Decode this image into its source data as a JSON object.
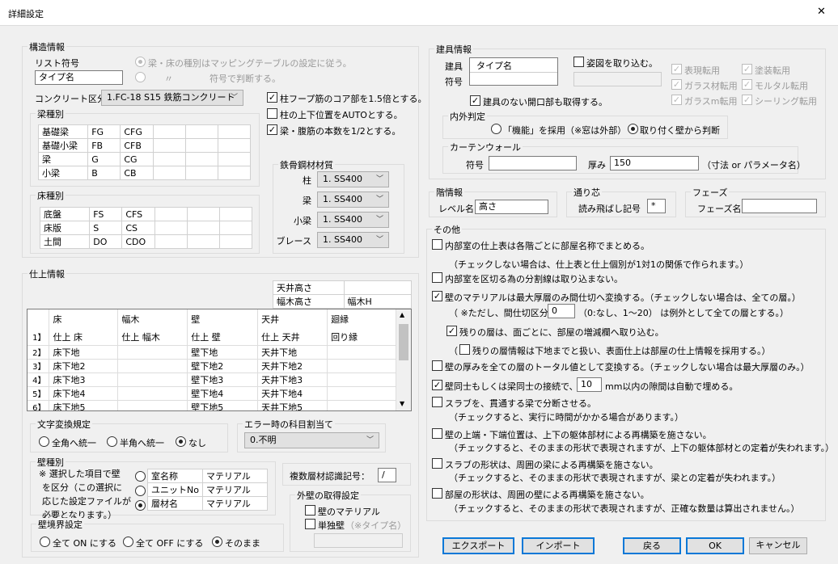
{
  "window": {
    "title": "詳細設定",
    "close": "✕"
  },
  "structure": {
    "title": "構造情報",
    "list_label": "リスト符号",
    "list_value": "タイプ名",
    "radio1": "梁・床の種別はマッピングテーブルの設定に従う。",
    "radio2_ditto": "〃",
    "radio2": "符号で判断する。",
    "concrete_label": "コンクリート区分",
    "concrete_value": "1.FC-18 S15 鉄筋コンクリート",
    "beam_title": "梁種別",
    "beam_rows": [
      [
        "基礎梁",
        "FG",
        "CFG",
        "",
        "",
        ""
      ],
      [
        "基礎小梁",
        "FB",
        "CFB",
        "",
        "",
        ""
      ],
      [
        "梁",
        "G",
        "CG",
        "",
        "",
        ""
      ],
      [
        "小梁",
        "B",
        "CB",
        "",
        "",
        ""
      ]
    ],
    "floor_title": "床種別",
    "floor_rows": [
      [
        "底盤",
        "FS",
        "CFS",
        "",
        "",
        ""
      ],
      [
        "床版",
        "S",
        "CS",
        "",
        "",
        ""
      ],
      [
        "土間",
        "DO",
        "CDO",
        "",
        "",
        ""
      ]
    ],
    "checks": [
      {
        "label": "柱フープ筋のコア部を1.5倍とする。",
        "checked": true
      },
      {
        "label": "柱の上下位置をAUTOとする。",
        "checked": false
      },
      {
        "label": "梁・腹筋の本数を1/2とする。",
        "checked": true
      }
    ],
    "steel_title": "鉄骨鋼材材質",
    "steel": [
      {
        "label": "柱",
        "value": "1. SS400"
      },
      {
        "label": "梁",
        "value": "1. SS400"
      },
      {
        "label": "小梁",
        "value": "1. SS400"
      },
      {
        "label": "ブレース",
        "value": "1. SS400"
      }
    ]
  },
  "finish": {
    "title": "仕上情報",
    "height_rows": [
      [
        "天井高さ",
        ""
      ],
      [
        "幅木高さ",
        "幅木H"
      ]
    ],
    "grid_header": [
      "",
      "床",
      "幅木",
      "壁",
      "天井",
      "廻縁"
    ],
    "grid_rows": [
      [
        "1】",
        "仕上 床",
        "仕上 幅木",
        "仕上 壁",
        "仕上 天井",
        "回り縁"
      ],
      [
        "2】",
        "床下地",
        "",
        "壁下地",
        "天井下地",
        ""
      ],
      [
        "3】",
        "床下地2",
        "",
        "壁下地2",
        "天井下地2",
        ""
      ],
      [
        "4】",
        "床下地3",
        "",
        "壁下地3",
        "天井下地3",
        ""
      ],
      [
        "5】",
        "床下地4",
        "",
        "壁下地4",
        "天井下地4",
        ""
      ],
      [
        "6】",
        "床下地5",
        "",
        "壁下地5",
        "天井下地5",
        ""
      ]
    ],
    "charconv_title": "文字変換規定",
    "charconv": [
      "全角へ統一",
      "半角へ統一",
      "なし"
    ],
    "error_title": "エラー時の科目割当て",
    "error_value": "0.不明",
    "walltype_title": "壁種別",
    "walltype_note": [
      "※ 選択した項目で壁",
      "を区分（この選択に",
      "応じた設定ファイルが",
      "必要となります。）"
    ],
    "walltype_rows": [
      [
        "室名称",
        "マテリアル"
      ],
      [
        "ユニットNo",
        "マテリアル"
      ],
      [
        "層材名",
        "マテリアル"
      ]
    ],
    "multi_label": "複数層材認識記号：",
    "multi_value": "/",
    "outer_title": "外壁の取得設定",
    "outer_cb1": "壁のマテリアル",
    "outer_cb2": "単独壁",
    "outer_cb2_note": "（※タイプ名）",
    "boundary_title": "壁境界設定",
    "boundary": [
      "全て ON にする",
      "全て OFF にする",
      "そのまま"
    ]
  },
  "fittings": {
    "title": "建具情報",
    "label1": "建具",
    "label2": "符号",
    "list_value": "タイプ名",
    "elev_cb": "姿図を取り込む。",
    "disabled_checks": [
      "表現転用",
      "塗装転用",
      "ガラス材転用",
      "モルタル転用",
      "ガラスm転用",
      "シーリング転用"
    ],
    "opening_cb": "建具のない開口部も取得する。",
    "inout_title": "内外判定",
    "inout": [
      "「機能」を採用（※窓は外部）",
      "取り付く壁から判断"
    ],
    "cw_title": "カーテンウォール",
    "cw_code_label": "符号",
    "cw_code": "",
    "cw_thick_label": "厚み",
    "cw_thick": "150",
    "cw_note": "（寸法 or パラメータ名）"
  },
  "level": {
    "title": "階情報",
    "label": "レベル名",
    "value": "高さ"
  },
  "grid": {
    "title": "通り芯",
    "label": "読み飛ばし記号",
    "value": "*"
  },
  "phase": {
    "title": "フェーズ",
    "label": "フェーズ名",
    "value": ""
  },
  "other": {
    "title": "その他",
    "c1": "内部室の仕上表は各階ごとに部屋名称でまとめる。",
    "c1n": "（チェックしない場合は、仕上表と仕上個別が1対1の関係で作られます。）",
    "c2": "内部室を区切る為の分割線は取り込まない。",
    "c3": "壁のマテリアルは最大厚層のみ間仕切へ変換する。（チェックしない場合は、全ての層。）",
    "c3a": "（ ※ただし、間仕切区分",
    "c3v": "0",
    "c3b": "（0:なし、1～20） は例外として全ての層とする。）",
    "c4": "残りの層は、面ごとに、部屋の増減欄へ取り込む。",
    "c5pre": "（",
    "c5": "残りの層情報は下地までと扱い、表面仕上は部屋の仕上情報を採用する。）",
    "c6": "壁の厚みを全ての層のトータル値として変換する。（チェックしない場合は最大厚層のみ。）",
    "c7": "壁同士もしくは梁同士の接続で、",
    "c7v": "10",
    "c7b": "mm以内の隙間は自動で埋める。",
    "c8": "スラブを、貫通する梁で分断させる。",
    "c8n": "（チェックすると、実行に時間がかかる場合があります。）",
    "c9": "壁の上端・下端位置は、上下の躯体部材による再構築を施さない。",
    "c9n": "（チェックすると、そのままの形状で表現されますが、上下の躯体部材との定着が失われます。）",
    "c10": "スラブの形状は、周囲の梁による再構築を施さない。",
    "c10n": "（チェックすると、そのままの形状で表現されますが、梁との定着が失われます。）",
    "c11": "部屋の形状は、周囲の壁による再構築を施さない。",
    "c11n": "（チェックすると、そのままの形状で表現されますが、正確な数量は算出されません。）"
  },
  "buttons": {
    "export": "エクスポート",
    "import": "インポート",
    "back": "戻る",
    "ok": "OK",
    "cancel": "キャンセル"
  }
}
